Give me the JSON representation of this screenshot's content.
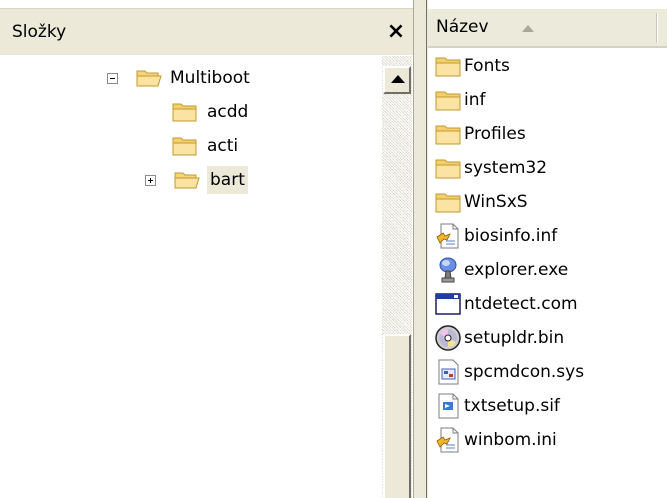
{
  "folders_pane": {
    "title": "Složky",
    "close_label": "×",
    "tree": [
      {
        "label": "Multiboot",
        "expander": "minus",
        "selected": false
      },
      {
        "label": "acdd",
        "expander": "none",
        "selected": false
      },
      {
        "label": "acti",
        "expander": "none",
        "selected": false
      },
      {
        "label": "bart",
        "expander": "plus",
        "selected": true
      }
    ]
  },
  "file_list": {
    "column_header": "Název",
    "sort": "ascending",
    "items": [
      {
        "name": "Fonts",
        "icon": "folder-icon"
      },
      {
        "name": "inf",
        "icon": "folder-icon"
      },
      {
        "name": "Profiles",
        "icon": "folder-icon"
      },
      {
        "name": "system32",
        "icon": "folder-icon"
      },
      {
        "name": "WinSxS",
        "icon": "folder-icon"
      },
      {
        "name": "biosinfo.inf",
        "icon": "setup-info-icon"
      },
      {
        "name": "explorer.exe",
        "icon": "explorer-exe-icon"
      },
      {
        "name": "ntdetect.com",
        "icon": "window-app-icon"
      },
      {
        "name": "setupldr.bin",
        "icon": "disc-icon"
      },
      {
        "name": "spcmdcon.sys",
        "icon": "system-file-icon"
      },
      {
        "name": "txtsetup.sif",
        "icon": "document-file-icon"
      },
      {
        "name": "winbom.ini",
        "icon": "setup-info-icon"
      }
    ]
  },
  "colors": {
    "chrome": "#ece9d8",
    "folder": "#f3c85a",
    "selection": "#ece9d8"
  }
}
